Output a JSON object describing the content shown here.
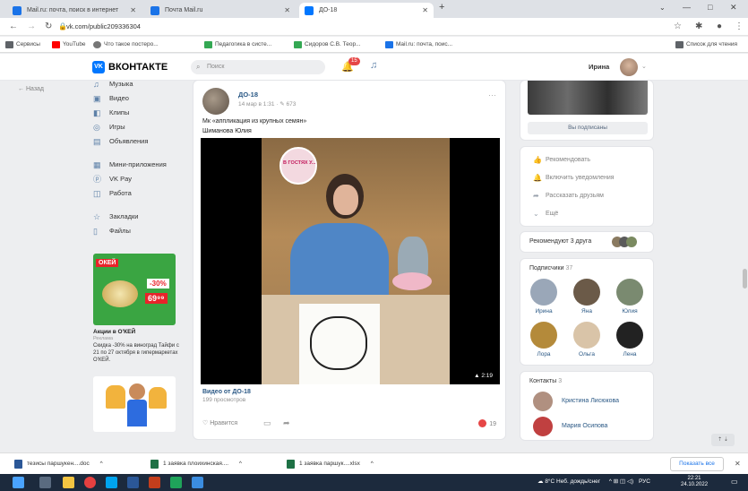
{
  "browser": {
    "tabs": [
      {
        "label": "Mail.ru: почта, поиск в интернет",
        "active": false,
        "favicon_color": "#1a73e8"
      },
      {
        "label": "Почта Mail.ru",
        "active": false,
        "favicon_color": "#1a73e8"
      },
      {
        "label": "ДО-18",
        "active": true,
        "favicon_color": "#0077ff"
      }
    ],
    "new_tab": "+",
    "url": "vk.com/public209336304",
    "bookmarks": [
      {
        "label": "Сервисы",
        "color": "#5f6368"
      },
      {
        "label": "YouTube",
        "color": "#ff0000"
      },
      {
        "label": "Что такое постерo...",
        "color": "#777777"
      },
      {
        "label": "Педагогика в систе...",
        "color": "#34a853"
      },
      {
        "label": "Сидоров С.В. Теор...",
        "color": "#34a853"
      },
      {
        "label": "Mail.ru: почта, поис...",
        "color": "#1a73e8"
      }
    ],
    "reading_list": "Список для чтения"
  },
  "vk": {
    "logo_text": "VK",
    "brand": "ВКОНТАКТЕ",
    "search_placeholder": "Поиск",
    "notifications_count": "15",
    "user_name": "Ирина",
    "back_link": "Назад",
    "menu": [
      {
        "label": "Музыка",
        "icon": "music-icon",
        "glyph": "♫"
      },
      {
        "label": "Видео",
        "icon": "video-icon",
        "glyph": "▣"
      },
      {
        "label": "Клипы",
        "icon": "clips-icon",
        "glyph": "◧"
      },
      {
        "label": "Игры",
        "icon": "games-icon",
        "glyph": "◎"
      },
      {
        "label": "Объявления",
        "icon": "ads-icon",
        "glyph": "▤"
      },
      {
        "label": "Мини-приложения",
        "icon": "apps-icon",
        "glyph": "▦"
      },
      {
        "label": "VK Pay",
        "icon": "pay-icon",
        "glyph": "ⓟ"
      },
      {
        "label": "Работа",
        "icon": "work-icon",
        "glyph": "◫"
      },
      {
        "label": "Закладки",
        "icon": "bookmark-icon",
        "glyph": "☆"
      },
      {
        "label": "Файлы",
        "icon": "files-icon",
        "glyph": "▯"
      }
    ],
    "ad": {
      "brand": "ОКЕЙ",
      "discount": "-30%",
      "price": "69⁹⁹",
      "title": "Акции в О'КЕЙ",
      "subtitle": "Реклама",
      "text": "Скидка -30% на виноград Тайфи с 21 по 27 октября в гипермаркетах О'КЕЙ."
    }
  },
  "post": {
    "author": "ДО-18",
    "date": "14 мар в 1:31 · ✎ 673",
    "text_line1": "Мк «аппликация из крупных семян»",
    "text_line2": "Шиманова Юлия",
    "video_duration": "2:19",
    "video_badge": "В ГОСТЯХ У...",
    "video_title": "Видео от ДО-18",
    "video_views": "199 просмотров",
    "like_label": "Нравится",
    "views_count": "19"
  },
  "right": {
    "subscribe_btn": "Вы подписаны",
    "actions": [
      {
        "label": "Рекомендовать",
        "icon": "thumb-icon",
        "glyph": "👍"
      },
      {
        "label": "Включить уведомления",
        "icon": "bell-icon",
        "glyph": "🔔"
      },
      {
        "label": "Рассказать друзьям",
        "icon": "share-icon",
        "glyph": "➦"
      },
      {
        "label": "Ещё",
        "icon": "chevron-down-icon",
        "glyph": "⌄"
      }
    ],
    "recommend": "Рекомендуют 3 друга",
    "subscribers_title": "Подписчики",
    "subscribers_count": "37",
    "subscribers": [
      {
        "name": "Ирина",
        "color": "#9aa7b8"
      },
      {
        "name": "Яна",
        "color": "#6b5a48"
      },
      {
        "name": "Юлия",
        "color": "#7a8a70"
      },
      {
        "name": "Лора",
        "color": "#b48a3a"
      },
      {
        "name": "Ольга",
        "color": "#d9c4a8"
      },
      {
        "name": "Лена",
        "color": "#222222"
      }
    ],
    "contacts_title": "Контакты",
    "contacts_count": "3",
    "contacts": [
      {
        "name": "Кристина Лисюкова",
        "color": "#b09080"
      },
      {
        "name": "Мария Осипова",
        "color": "#c04040"
      }
    ]
  },
  "downloads": [
    {
      "label": "тезисы паршукен....doc"
    },
    {
      "label": "1 заявка плоихинская...."
    },
    {
      "label": "1 заявка паршук....xlsx"
    }
  ],
  "show_all": "Показать все",
  "taskbar": {
    "weather": "8°C Неб. дождь/снег",
    "lang": "РУС",
    "time": "22:21",
    "date": "24.10.2022"
  }
}
